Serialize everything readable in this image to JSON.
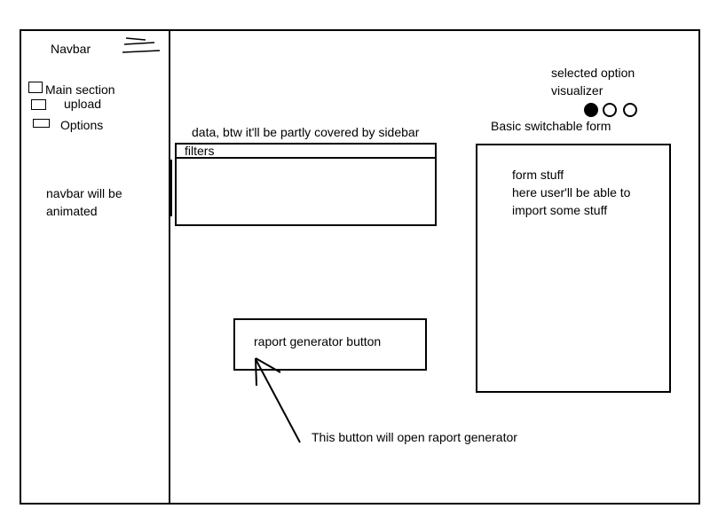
{
  "sidebar": {
    "title": "Navbar",
    "items": [
      {
        "label": "Main section"
      },
      {
        "label": "upload"
      },
      {
        "label": "Options"
      }
    ],
    "note_line1": "navbar will be",
    "note_line2": "animated"
  },
  "visualizer": {
    "label_line1": "selected option",
    "label_line2": "visualizer",
    "selected_index": 0,
    "option_count": 3
  },
  "data_section": {
    "caption": "data, btw it'll be partly covered by sidebar",
    "filters_label": "filters"
  },
  "form_section": {
    "caption": "Basic switchable form",
    "line1": "form stuff",
    "line2": "here user'll be able to",
    "line3": "import some stuff"
  },
  "report_button": {
    "label": "raport generator button",
    "annotation": "This button will open raport generator"
  }
}
